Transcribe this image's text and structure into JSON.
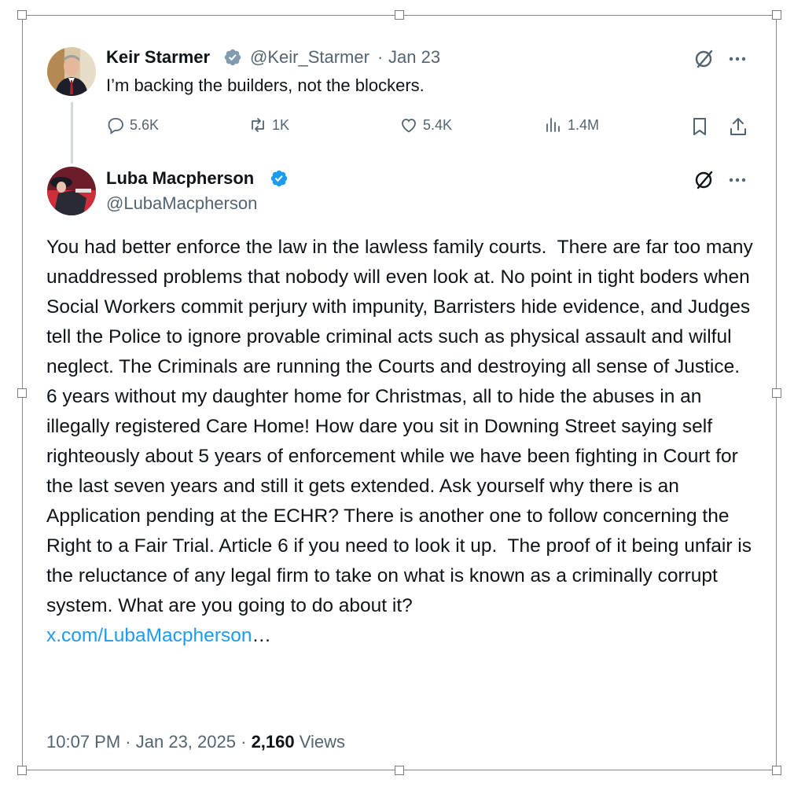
{
  "original_tweet": {
    "author_name": "Keir Starmer",
    "author_handle": "@Keir_Starmer",
    "separator": "·",
    "date": "Jan 23",
    "text": "I’m backing the builders, not the blockers.",
    "replies": "5.6K",
    "reposts": "1K",
    "likes": "5.4K",
    "views": "1.4M"
  },
  "reply_tweet": {
    "author_name": "Luba Macpherson",
    "author_handle": "@LubaMacpherson",
    "text": "You had better enforce the law in the lawless family courts.  There are far too many unaddressed problems that nobody will even look at. No point in tight boders when Social Workers commit perjury with impunity, Barristers hide evidence, and Judges tell the Police to ignore provable criminal acts such as physical assault and wilful neglect. The Criminals are running the Courts and destroying all sense of Justice. 6 years without my daughter home for Christmas, all to hide the abuses in an illegally registered Care Home! How dare you sit in Downing Street saying self righteously about 5 years of enforcement while we have been fighting in Court for the last seven years and still it gets extended. Ask yourself why there is an Application pending at the ECHR? There is another one to follow concerning the Right to a Fair Trial. Article 6 if you need to look it up.  The proof of it being unfair is the reluctance of any legal firm to take on what is known as a criminally corrupt system. What are you going to do about it?",
    "link_text": "x.com/LubaMacpherson",
    "link_ellipsis": "…",
    "time": "10:07 PM",
    "separator": "·",
    "full_date": "Jan 23, 2025",
    "views_count": "2,160",
    "views_label": "Views"
  },
  "colors": {
    "text": "#0f1419",
    "secondary": "#536471",
    "link": "#1d9bf0",
    "verified": "#1d9bf0"
  },
  "icons": [
    "verified-badge-icon",
    "grok-icon",
    "more-icon",
    "reply-icon",
    "repost-icon",
    "like-icon",
    "views-icon",
    "bookmark-icon",
    "share-icon"
  ]
}
